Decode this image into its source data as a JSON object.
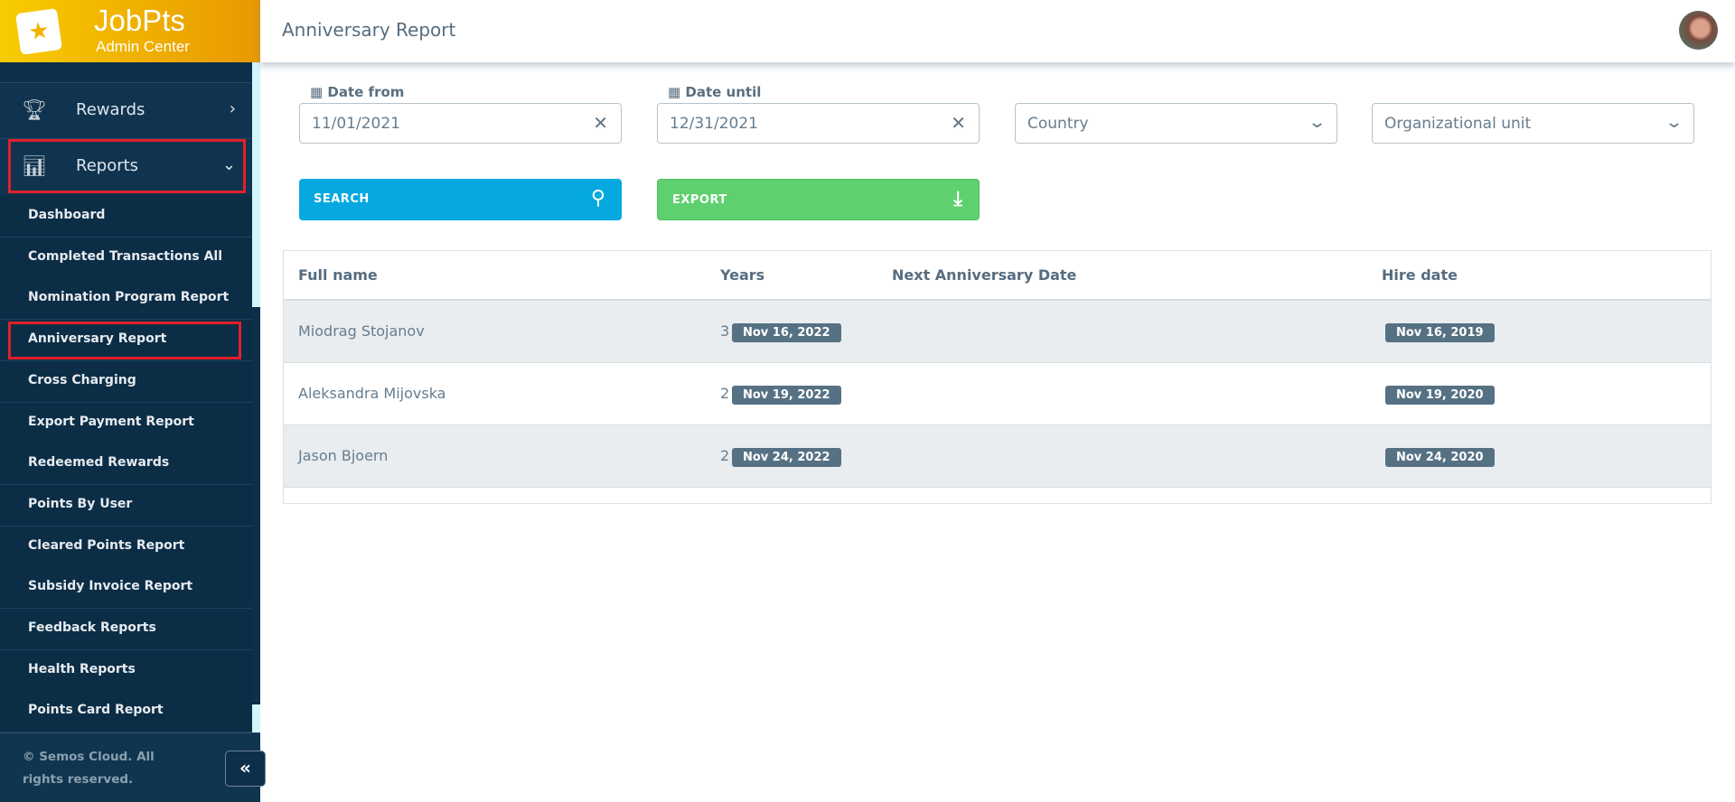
{
  "brand": {
    "title": "JobPts",
    "subtitle": "Admin Center"
  },
  "sidebar": {
    "main": [
      {
        "label": "Rewards",
        "icon": "trophy-icon"
      },
      {
        "label": "Reports",
        "icon": "bar-chart-icon"
      }
    ],
    "sub": [
      "Dashboard",
      "Completed Transactions All",
      "Nomination Program Report",
      "Anniversary Report",
      "Cross Charging",
      "Export Payment Report",
      "Redeemed Rewards",
      "Points By User",
      "Cleared Points Report",
      "Subsidy Invoice Report",
      "Feedback Reports",
      "Health Reports",
      "Points Card Report"
    ],
    "active": "Anniversary Report",
    "footer": "© Semos Cloud. All rights reserved.",
    "collapse": "«"
  },
  "header": {
    "title": "Anniversary Report"
  },
  "filters": {
    "date_from": {
      "label": "Date from",
      "value": "11/01/2021"
    },
    "date_until": {
      "label": "Date until",
      "value": "12/31/2021"
    },
    "country": {
      "placeholder": "Country"
    },
    "org_unit": {
      "placeholder": "Organizational unit"
    }
  },
  "buttons": {
    "search": "SEARCH",
    "export": "EXPORT"
  },
  "colors": {
    "search": "#05a9e0",
    "export": "#5fd06f",
    "sidebar": "#0e2f4a",
    "badge": "#567184"
  },
  "table": {
    "columns": [
      "Full name",
      "Years",
      "Next Anniversary Date",
      "Hire date"
    ],
    "rows": [
      [
        "Miodrag Stojanov",
        "3",
        "Nov 16, 2022",
        "Nov 16, 2019"
      ],
      [
        "Aleksandra Mijovska",
        "2",
        "Nov 19, 2022",
        "Nov 19, 2020"
      ],
      [
        "Jason Bjoern",
        "2",
        "Nov 24, 2022",
        "Nov 24, 2020"
      ]
    ]
  }
}
